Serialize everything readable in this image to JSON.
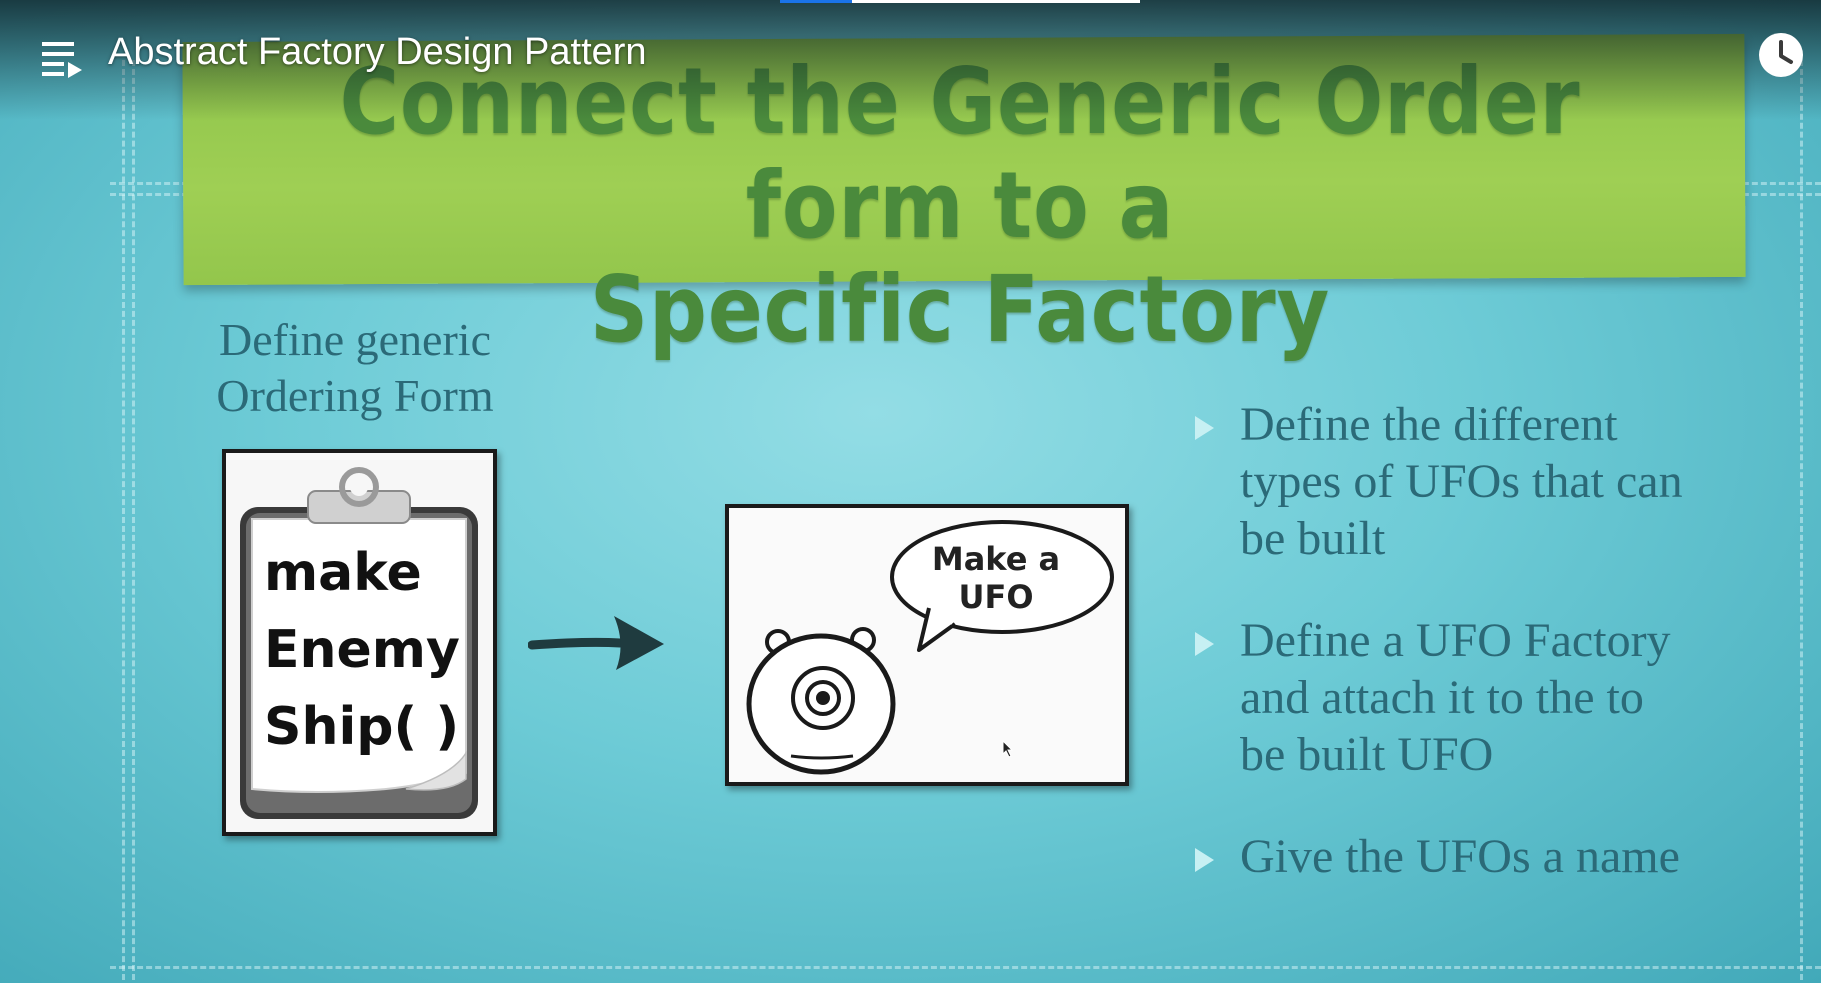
{
  "player": {
    "video_title": "Abstract Factory Design Pattern",
    "playlist_icon": "playlist-icon",
    "watch_later_icon": "clock-icon",
    "progress_played": 0.2
  },
  "slide": {
    "banner_title_lines": [
      "Connect the Generic Order form to a",
      "Specific Factory"
    ],
    "left_caption_lines": [
      "Define generic",
      "Ordering Form"
    ],
    "clipboard_lines": [
      "make",
      "Enemy",
      "Ship( )"
    ],
    "speech_lines": [
      "Make a",
      "UFO"
    ],
    "bullets": [
      [
        "Define the different",
        "types of UFOs that can",
        "be built"
      ],
      [
        "Define a UFO Factory",
        "and attach it to the to",
        "be built UFO"
      ],
      [
        "Give the UFOs a name"
      ]
    ],
    "colors": {
      "banner_green": "#9fcf54",
      "banner_text": "#4a8a3c",
      "slide_text": "#2b6a78",
      "slide_background": "#6dcbd6",
      "progress_blue": "#1a73e8"
    }
  }
}
